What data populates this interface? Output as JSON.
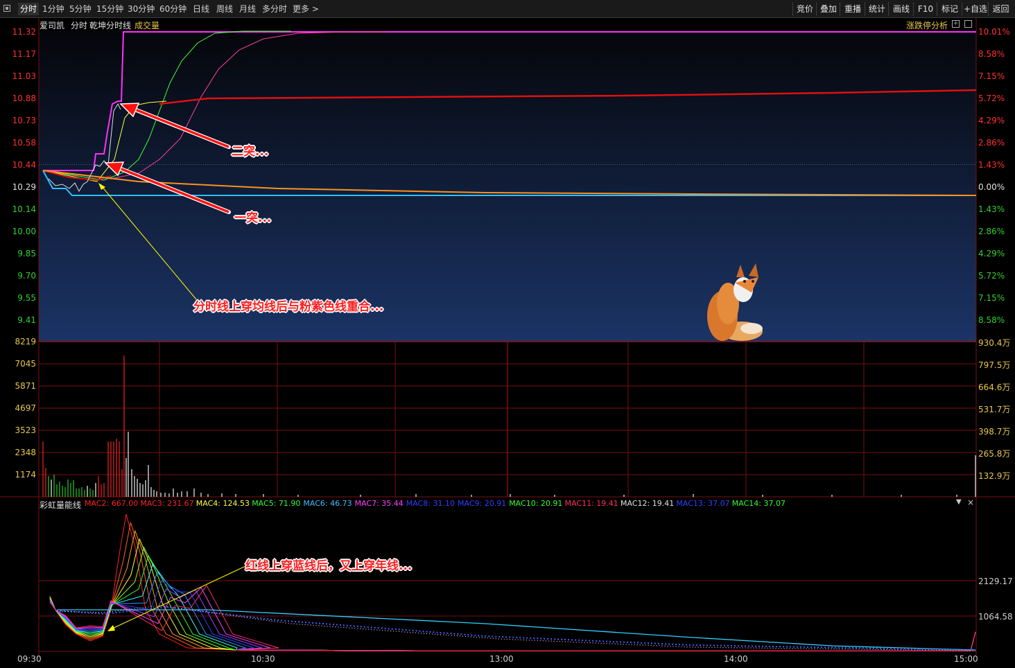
{
  "tabs": [
    "分时",
    "1分钟",
    "5分钟",
    "15分钟",
    "30分钟",
    "60分钟",
    "日线",
    "周线",
    "月线",
    "多分时",
    "更多 >"
  ],
  "right_tabs": [
    "竞价",
    "叠加",
    "重播",
    "统计",
    "画线",
    "F10",
    "标记",
    "+自选",
    "返回"
  ],
  "header": {
    "stock": "爱司凯",
    "mode": "分时",
    "indicator": "乾坤分时线",
    "volume_label": "成交量",
    "analysis": "涨跌停分析"
  },
  "price_axis": {
    "left": [
      "11.32",
      "11.17",
      "11.03",
      "10.88",
      "10.73",
      "10.58",
      "10.44",
      "10.29",
      "10.14",
      "10.00",
      "9.85",
      "9.70",
      "9.55",
      "9.41"
    ],
    "right": [
      "10.01%",
      "8.58%",
      "7.15%",
      "5.72%",
      "4.29%",
      "2.86%",
      "1.43%",
      "0.00%",
      "1.43%",
      "2.86%",
      "4.29%",
      "5.72%",
      "7.15%",
      "8.58%"
    ]
  },
  "volume_axis": {
    "left": [
      "8219",
      "7045",
      "5871",
      "4697",
      "3523",
      "2348",
      "1174"
    ],
    "right": [
      "930.4万",
      "797.5万",
      "664.6万",
      "531.7万",
      "398.7万",
      "265.8万",
      "132.9万"
    ]
  },
  "indicator_panel": {
    "name": "彩虹量能线",
    "items": [
      {
        "label": "MAC2: 667.00",
        "color": "#ff2020"
      },
      {
        "label": "MAC3: 231.67",
        "color": "#ff2020"
      },
      {
        "label": "MAC4: 124.53",
        "color": "#ffff40"
      },
      {
        "label": "MAC5: 71.90",
        "color": "#30ff30"
      },
      {
        "label": "MAC6: 46.73",
        "color": "#40c0ff"
      },
      {
        "label": "MAC7: 35.44",
        "color": "#ff40ff"
      },
      {
        "label": "MAC8: 31.10",
        "color": "#3040ff"
      },
      {
        "label": "MAC9: 20.91",
        "color": "#3040ff"
      },
      {
        "label": "MAC10: 20.91",
        "color": "#30ff30"
      },
      {
        "label": "MAC11: 19.41",
        "color": "#ff3060"
      },
      {
        "label": "MAC12: 19.41",
        "color": "#e0e0e0"
      },
      {
        "label": "MAC13: 37.07",
        "color": "#3040ff"
      },
      {
        "label": "MAC14: 37.07",
        "color": "#30ff30"
      }
    ],
    "axis": [
      "2129.17",
      "1064.58"
    ]
  },
  "time_axis": [
    "09:30",
    "10:30",
    "13:00",
    "14:00",
    "15:00"
  ],
  "annotations": {
    "second_breakout": "二突...",
    "first_breakout": "一突...",
    "cross_note": "分时线上穿均线后与粉紫色线重合...",
    "indicator_note": "红线上穿蓝线后，又上穿年线..."
  },
  "colors": {
    "up": "#ff3030",
    "down": "#30d030",
    "flat": "#e0e0e0",
    "grid": "#7a1010",
    "panel_top": "#05060a",
    "panel_bottom": "#1b3466"
  },
  "chart_data": {
    "type": "line",
    "title": "",
    "x": [
      "09:30",
      "09:35",
      "09:40",
      "09:45",
      "09:50",
      "09:55",
      "10:00",
      "10:05",
      "10:10",
      "10:30",
      "11:30",
      "13:00",
      "14:00",
      "15:00"
    ],
    "series": [
      {
        "name": "分时",
        "values": [
          10.44,
          10.26,
          10.24,
          10.22,
          10.22,
          10.29,
          10.3,
          10.42,
          10.86,
          11.32,
          11.32,
          11.32,
          11.32,
          11.32
        ]
      },
      {
        "name": "均价",
        "values": [
          10.44,
          10.4,
          10.37,
          10.35,
          10.33,
          10.33,
          10.32,
          10.31,
          10.3,
          10.28,
          10.23,
          10.22,
          10.22,
          10.22
        ]
      }
    ],
    "ylim": [
      9.41,
      11.32
    ]
  }
}
